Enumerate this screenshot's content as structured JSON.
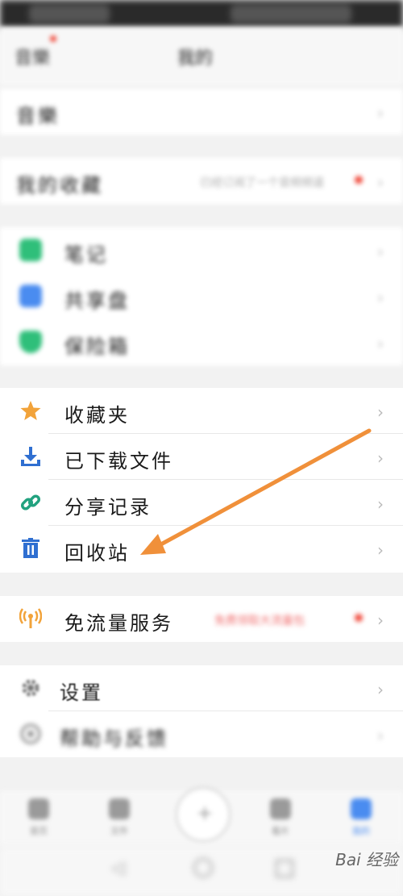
{
  "header": {
    "left": "音樂",
    "title": "我的"
  },
  "rows_top": [
    {
      "label": "音樂"
    },
    {
      "label": "我的收藏",
      "value": "已经订阅了一个音频频道"
    }
  ],
  "group1": [
    "笔记",
    "共享盘",
    "保险箱"
  ],
  "group2": [
    {
      "label": "收藏夹",
      "icon": "star-icon"
    },
    {
      "label": "已下载文件",
      "icon": "download-icon"
    },
    {
      "label": "分享记录",
      "icon": "link-icon"
    },
    {
      "label": "回收站",
      "icon": "trash-icon"
    }
  ],
  "group3": {
    "label": "免流量服务",
    "icon": "signal-icon",
    "value": "免费领取大流量包"
  },
  "group4": [
    {
      "label": "设置",
      "icon": "gear-icon"
    },
    {
      "label": "帮助与反馈",
      "icon": "help-icon"
    }
  ],
  "bottom_nav": [
    "首页",
    "文件",
    "",
    "看片",
    "我的"
  ],
  "watermark": "Bai 经验",
  "colors": {
    "star": "#f2a33a",
    "download": "#2f6fd1",
    "link": "#22a27f",
    "trash": "#2f6fd1",
    "signal": "#f2a33a",
    "arrow": "#f0903a"
  }
}
